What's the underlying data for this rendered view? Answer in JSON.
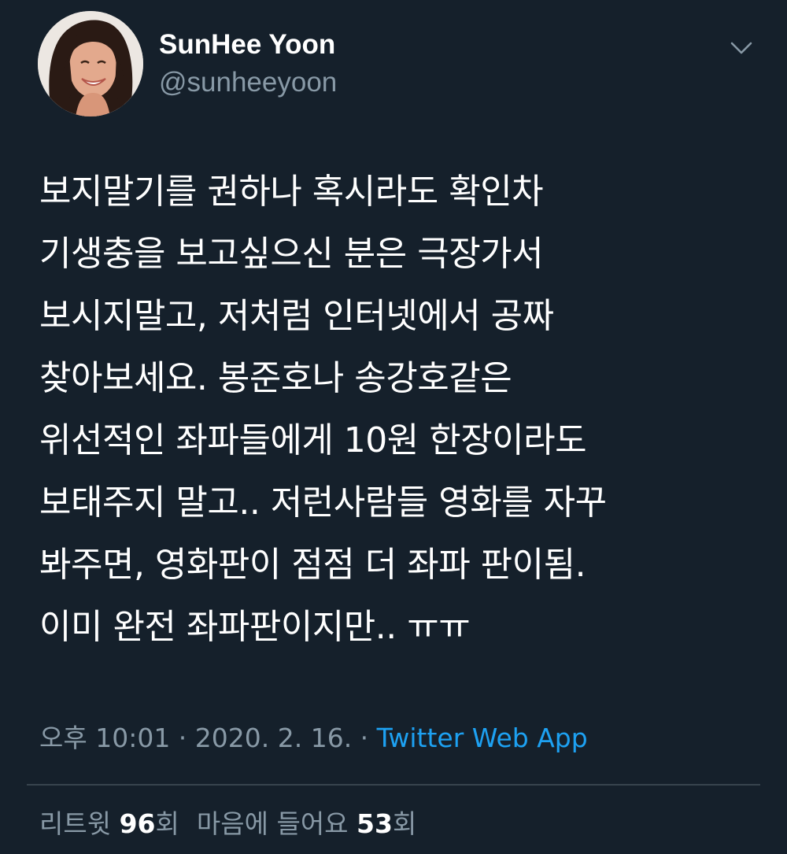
{
  "tweet": {
    "author": {
      "display_name": "SunHee Yoon",
      "handle": "@sunheeyoon",
      "avatar_icon": "profile-photo"
    },
    "menu_icon": "chevron-down-icon",
    "text_lines": [
      "보지말기를 권하나 혹시라도 확인차",
      "기생충을 보고싶으신 분은 극장가서",
      "보시지말고, 저처럼 인터넷에서 공짜",
      "찾아보세요. 봉준호나 송강호같은",
      "위선적인 좌파들에게 10원 한장이라도",
      "보태주지 말고.. 저런사람들 영화를 자꾸",
      "봐주면, 영화판이 점점 더 좌파 판이됨.",
      "이미 완전 좌파판이지만.. ㅠㅠ"
    ],
    "timestamp": "오후 10:01 · 2020. 2. 16. · ",
    "source": "Twitter Web App",
    "stats": {
      "retweet_label": "리트윗 ",
      "retweet_count": "96",
      "retweet_suffix": "회",
      "like_label": "마음에 들어요 ",
      "like_count": "53",
      "like_suffix": "회"
    }
  },
  "colors": {
    "background": "#15202b",
    "primary_text": "#ffffff",
    "secondary_text": "#8899a6",
    "link": "#1da1f2",
    "divider": "#38444d"
  }
}
